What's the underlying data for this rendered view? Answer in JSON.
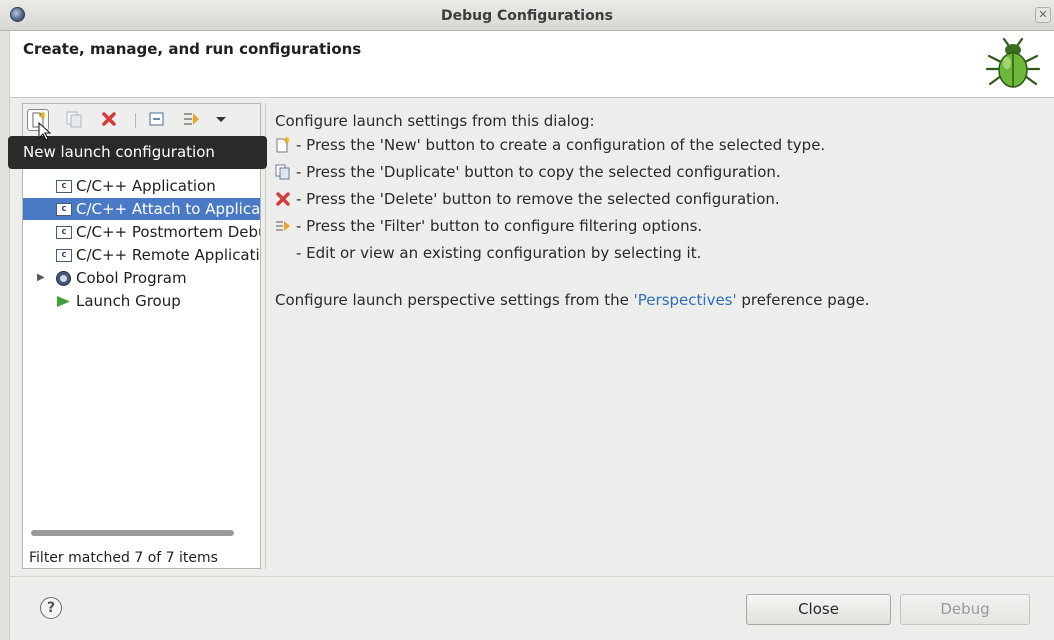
{
  "window": {
    "title": "Debug Configurations",
    "close_glyph": "✕"
  },
  "header": {
    "title": "Create, manage, and run configurations"
  },
  "tooltip": {
    "text": "New launch configuration"
  },
  "tree": {
    "items": [
      {
        "label": "C/C++ Application",
        "icon": "c-app-icon",
        "selected": false
      },
      {
        "label": "C/C++ Attach to Application",
        "icon": "c-app-icon",
        "selected": true
      },
      {
        "label": "C/C++ Postmortem Debugger",
        "icon": "c-app-icon",
        "selected": false
      },
      {
        "label": "C/C++ Remote Application",
        "icon": "c-app-icon",
        "selected": false
      },
      {
        "label": "Cobol Program",
        "icon": "cobol-icon",
        "selected": false
      },
      {
        "label": "Launch Group",
        "icon": "launch-group-icon",
        "selected": false
      }
    ],
    "filter_status": "Filter matched 7 of 7 items"
  },
  "info": {
    "intro": "Configure launch settings from this dialog:",
    "lines": [
      {
        "icon": "new-config-icon",
        "text": "- Press the 'New' button to create a configuration of the selected type."
      },
      {
        "icon": "duplicate-icon",
        "text": "- Press the 'Duplicate' button to copy the selected configuration."
      },
      {
        "icon": "delete-icon",
        "text": "- Press the 'Delete' button to remove the selected configuration."
      },
      {
        "icon": "filter-icon",
        "text": "- Press the 'Filter' button to configure filtering options."
      },
      {
        "icon": "",
        "text": "- Edit or view an existing configuration by selecting it."
      }
    ],
    "perspective_prefix": "Configure launch perspective settings from the ",
    "perspective_link": "'Perspectives'",
    "perspective_suffix": " preference page."
  },
  "footer": {
    "help_glyph": "?",
    "close_label": "Close",
    "debug_label": "Debug"
  },
  "colors": {
    "selection": "#4a7ac5",
    "link": "#2f6fb6",
    "delete_red": "#d63a3a",
    "launch_green": "#3fa03a"
  }
}
